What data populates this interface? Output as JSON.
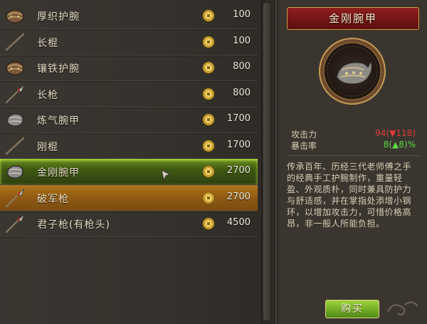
{
  "items": [
    {
      "name": "厚织护腕",
      "price": "100",
      "icon": "wristguard-icon"
    },
    {
      "name": "长棍",
      "price": "100",
      "icon": "staff-icon"
    },
    {
      "name": "镶铁护腕",
      "price": "800",
      "icon": "wristguard-icon"
    },
    {
      "name": "长枪",
      "price": "800",
      "icon": "spear-icon"
    },
    {
      "name": "炼气腕甲",
      "price": "1700",
      "icon": "bracer-icon"
    },
    {
      "name": "刚棍",
      "price": "1700",
      "icon": "staff-icon"
    },
    {
      "name": "金刚腕甲",
      "price": "2700",
      "icon": "bracer-icon",
      "state": "selected"
    },
    {
      "name": "破军枪",
      "price": "2700",
      "icon": "spear-icon",
      "state": "hover"
    },
    {
      "name": "君子枪(有枪头)",
      "price": "4500",
      "icon": "spear-icon"
    }
  ],
  "detail": {
    "title": "金刚腕甲",
    "portrait_icon": "bracer-portrait-icon",
    "stats": [
      {
        "label": "攻击力",
        "value": "94(▼118)",
        "tone": "red"
      },
      {
        "label": "暴击率",
        "value": "8(▲8)%",
        "tone": "green"
      }
    ],
    "description": "传承百年、历经三代老师傅之手的经典手工护腕制作，重量轻盈、外观质朴，同时兼具防护力与舒适感，并在掌指处添增小钢环，以增加攻击力，可惜价格高昂，非一般人所能负担。",
    "buy_label": "购买"
  },
  "colors": {
    "selected_row": "#5a7d1a",
    "hover_row": "#9a651a",
    "title_banner": "#7a1818",
    "buy_button": "#72ac26",
    "coin": "#d9b13a"
  }
}
